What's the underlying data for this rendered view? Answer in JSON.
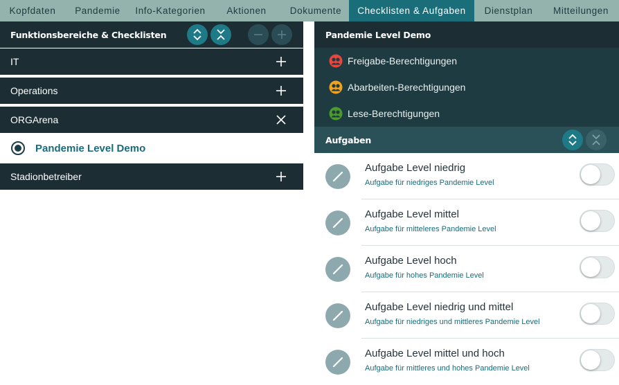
{
  "tabs": [
    {
      "label": "Kopfdaten",
      "active": false
    },
    {
      "label": "Pandemie",
      "active": false
    },
    {
      "label": "Info-Kategorien",
      "active": false
    },
    {
      "label": "Aktionen",
      "active": false
    },
    {
      "label": "Dokumente",
      "active": false
    },
    {
      "label": "Checklisten & Aufgaben",
      "active": true
    },
    {
      "label": "Dienstplan",
      "active": false
    },
    {
      "label": "Mitteilungen",
      "active": false
    }
  ],
  "left": {
    "title": "Funktionsbereiche & Checklisten",
    "areas": [
      {
        "label": "IT",
        "icon": "plus-icon"
      },
      {
        "label": "Operations",
        "icon": "plus-icon"
      },
      {
        "label": "ORGArena",
        "icon": "close-icon",
        "expanded": true
      },
      {
        "label": "Stadionbetreiber",
        "icon": "plus-icon"
      }
    ],
    "selected_checklist": "Pandemie Level Demo"
  },
  "right": {
    "title": "Pandemie Level Demo",
    "permissions": [
      {
        "label": "Freigabe-Berechtigungen",
        "color": "#e8453c"
      },
      {
        "label": "Abarbeiten-Berechtigungen",
        "color": "#f0a21e"
      },
      {
        "label": "Lese-Berechtigungen",
        "color": "#4a9a2c"
      }
    ],
    "tasks_title": "Aufgaben",
    "tasks": [
      {
        "title": "Aufgabe Level niedrig",
        "desc": "Aufgabe für niedriges Pandemie Level",
        "enabled": false
      },
      {
        "title": "Aufgabe Level mittel",
        "desc": "Aufgabe für mitteleres Pandemie Level",
        "enabled": false
      },
      {
        "title": "Aufgabe Level hoch",
        "desc": "Aufgabe für hohes Pandemie Level",
        "enabled": false
      },
      {
        "title": "Aufgabe Level niedrig und mittel",
        "desc": "Aufgabe für niedriges und mittleres Pandemie Level",
        "enabled": false
      },
      {
        "title": "Aufgabe Level mittel und hoch",
        "desc": "Aufgabe für mittleres und hohes Pandemie Level",
        "enabled": false
      }
    ]
  },
  "colors": {
    "accent": "#196e7a",
    "dark": "#1c2d34",
    "tabbar": "#95b3ad"
  }
}
